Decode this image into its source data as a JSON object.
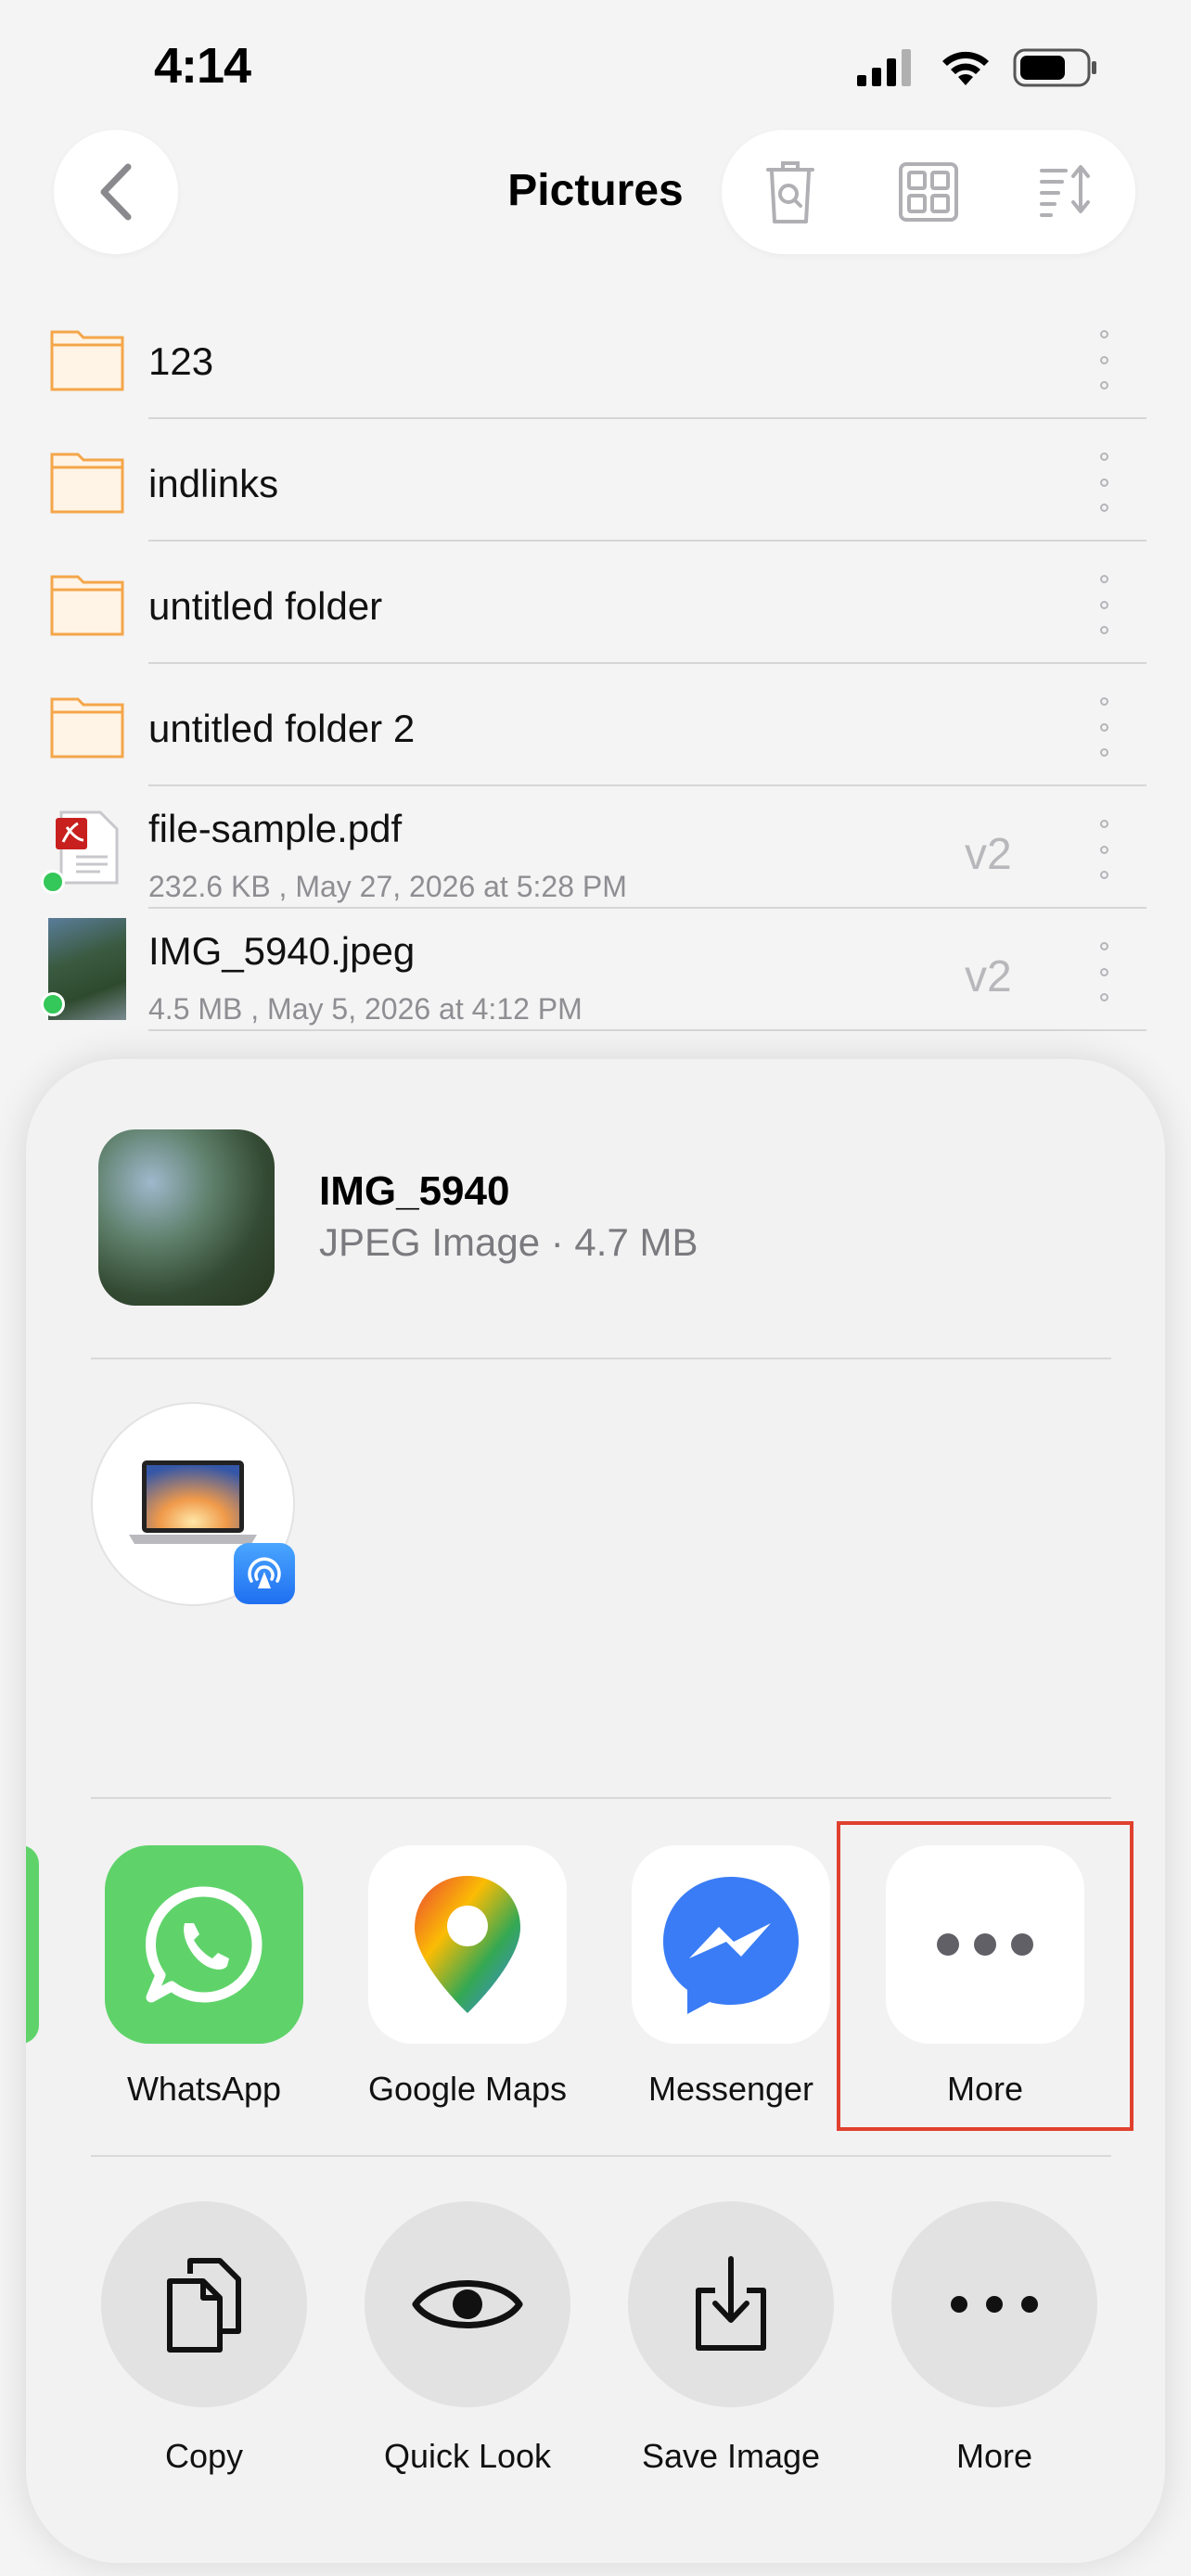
{
  "status_bar": {
    "time": "4:14"
  },
  "header": {
    "title": "Pictures"
  },
  "files": [
    {
      "name": "123",
      "type": "folder"
    },
    {
      "name": "indlinks",
      "type": "folder"
    },
    {
      "name": "untitled folder",
      "type": "folder"
    },
    {
      "name": "untitled folder 2",
      "type": "folder"
    },
    {
      "name": "file-sample.pdf",
      "type": "pdf",
      "meta": "232.6 KB , May 27, 2026 at 5:28 PM",
      "version": "v2"
    },
    {
      "name": "IMG_5940.jpeg",
      "type": "image",
      "meta": "4.5 MB , May 5, 2026 at 4:12 PM",
      "version": "v2"
    }
  ],
  "share_sheet": {
    "file_name": "IMG_5940",
    "file_subtitle": "JPEG Image · 4.7 MB",
    "apps": [
      {
        "label": "WhatsApp",
        "icon": "whatsapp-icon"
      },
      {
        "label": "Google Maps",
        "icon": "google-maps-icon"
      },
      {
        "label": "Messenger",
        "icon": "messenger-icon"
      },
      {
        "label": "More",
        "icon": "more-icon"
      }
    ],
    "actions": [
      {
        "label": "Copy",
        "icon": "copy-icon"
      },
      {
        "label": "Quick Look",
        "icon": "eye-icon"
      },
      {
        "label": "Save Image",
        "icon": "save-image-icon"
      },
      {
        "label": "More",
        "icon": "more-icon"
      }
    ]
  },
  "colors": {
    "folder": "#f4a64a",
    "highlight": "#e0412f",
    "whatsapp": "#5fd36a",
    "messenger": "#2f7bf6"
  }
}
